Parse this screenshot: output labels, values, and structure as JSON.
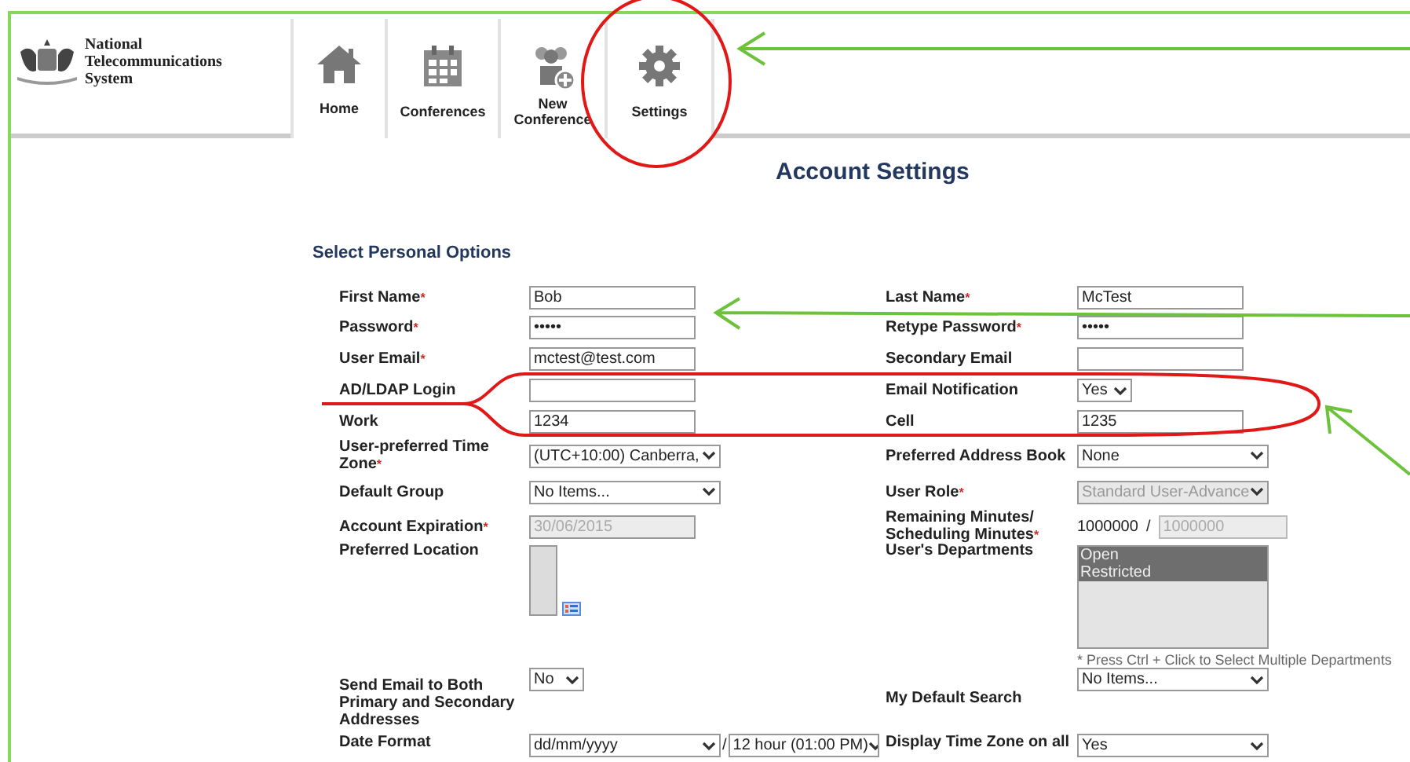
{
  "logo": {
    "lines": [
      "National",
      "Telecommunications",
      "System"
    ]
  },
  "nav": [
    {
      "label": "Home",
      "kind": "home"
    },
    {
      "label": "Conferences",
      "kind": "conferences"
    },
    {
      "label": "New\nConference",
      "kind": "new_conference"
    },
    {
      "label": "Settings",
      "kind": "settings"
    }
  ],
  "page_title": "Account Settings",
  "section_title": "Select Personal Options",
  "rows": [
    {
      "left": {
        "label": "First Name",
        "mark": "*",
        "kind": "text",
        "value": "Bob"
      },
      "right": {
        "label": "Last Name",
        "mark": "*",
        "kind": "text",
        "value": "McTest"
      }
    },
    {
      "left": {
        "label": "Password",
        "mark": "*",
        "kind": "text",
        "value": "•••••"
      },
      "right": {
        "label": "Retype Password",
        "mark": "*",
        "kind": "text",
        "value": "•••••"
      }
    },
    {
      "left": {
        "label": "User Email",
        "mark": "*",
        "kind": "text",
        "value": "mctest@test.com"
      },
      "right": {
        "label": "Secondary Email",
        "kind": "text"
      }
    },
    {
      "left": {
        "label": "AD/LDAP Login",
        "kind": "text"
      },
      "right": {
        "label": "Email Notification",
        "kind": "small_select",
        "value": "Yes"
      }
    },
    {
      "left": {
        "label": "Work",
        "kind": "text",
        "value": "1234"
      },
      "right": {
        "label": "Cell",
        "kind": "text",
        "value": "1235"
      }
    },
    {
      "left": {
        "label": "User-preferred Time Zone",
        "mark": "*",
        "kind": "select",
        "value": "(UTC+10:00) Canberra,"
      },
      "right": {
        "label": "Preferred Address Book",
        "kind": "select",
        "value": "None"
      }
    },
    {
      "left": {
        "label": "Default Group",
        "kind": "select",
        "value": "No Items..."
      },
      "right": {
        "label": "User Role",
        "mark": "*",
        "kind": "select",
        "value": "Standard User-Advance",
        "disabled": true
      }
    },
    {
      "left": {
        "label": "Account Expiration",
        "mark": "*",
        "kind": "text",
        "value": "30/06/2015",
        "disabled": true
      },
      "right": {
        "label": "Remaining Minutes/ Scheduling Minutes",
        "mark": "*",
        "kind": "minutes",
        "value": "1000000",
        "separator": "/",
        "limit": "1000000"
      }
    },
    {
      "left": {
        "label": "Preferred Location",
        "kind": "location"
      },
      "right": {
        "label": "User's Departments",
        "kind": "listbox",
        "items": [
          {
            "label": "Open",
            "selected": true
          },
          {
            "label": "Restricted",
            "selected": true
          }
        ],
        "hint": "* Press Ctrl + Click to Select Multiple Departments"
      }
    },
    {
      "left": {
        "label": "Send Email to Both Primary and Secondary Addresses",
        "kind": "small_select",
        "value": "No"
      },
      "right": {
        "label": "My Default Search",
        "kind": "select",
        "value": "No Items..."
      }
    },
    {
      "left": {
        "label": "Date Format",
        "kind": "date_format",
        "value": "dd/mm/yyyy",
        "separator": "/",
        "time_value": "12 hour (01:00 PM)"
      },
      "right": {
        "label": "Display Time Zone on all",
        "kind": "select",
        "value": "Yes"
      }
    }
  ],
  "annotations": [
    {
      "kind": "circle"
    },
    {
      "kind": "ellipse"
    },
    {
      "kind": "arrow"
    },
    {
      "kind": "arrow"
    },
    {
      "kind": "arrow"
    }
  ]
}
